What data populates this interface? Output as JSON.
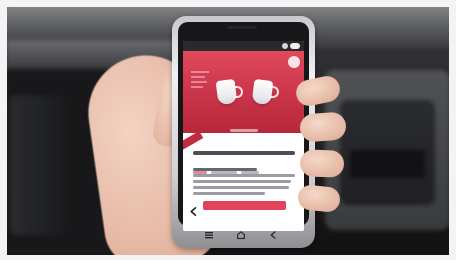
{
  "scene": {
    "description": "",
    "palette": {
      "accent": "#e14a5d",
      "accent_dark": "#b7273b",
      "background": "#1b1b1d",
      "skin": "#e6b9a5"
    }
  },
  "device": {
    "brand": "",
    "nav_icons": [
      "menu-icon",
      "home-icon",
      "back-icon"
    ]
  },
  "app_screen": {
    "icons": [
      "share-icon",
      "back-arrow-icon"
    ],
    "cta_label": "",
    "title": "",
    "body": ""
  }
}
